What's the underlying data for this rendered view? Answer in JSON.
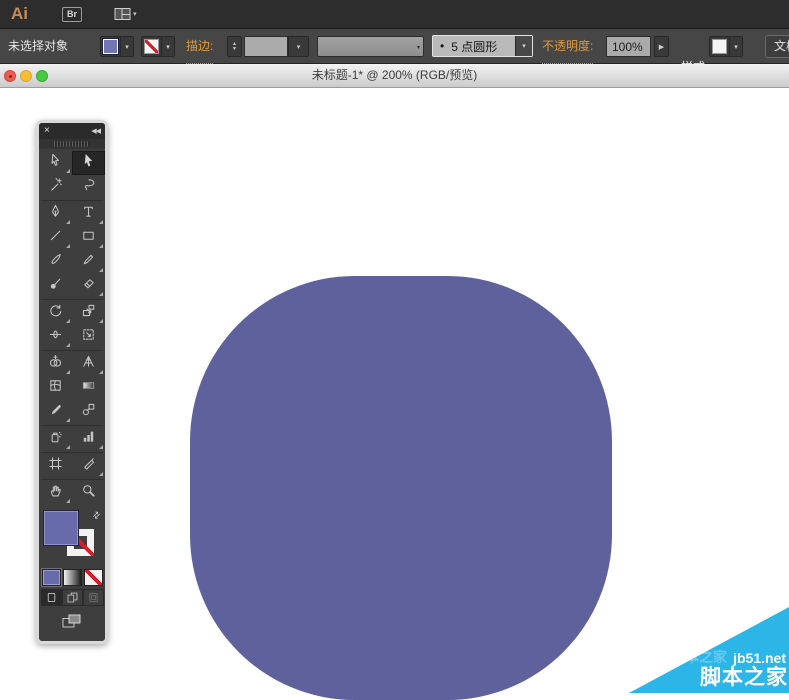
{
  "app_bar": {
    "logo": "Ai",
    "bridge_button": "Br"
  },
  "control_bar": {
    "status_label": "未选择对象",
    "fill_swatch_color": "#7376b4",
    "stroke_swatch": "none",
    "stroke_label": "描边:",
    "stroke_weight_value": "",
    "brush_name": "5 点圆形",
    "opacity_label": "不透明度:",
    "opacity_value": "100%",
    "style_label": "样式:",
    "document_setup_label": "文档设置"
  },
  "window": {
    "title": "未标题-1* @ 200% (RGB/预览)"
  },
  "icons": {
    "chevron-down": "▾",
    "spinner-up": "▲",
    "spinner-down": "▼",
    "expand-right": "▶",
    "bullet": "•",
    "close": "×",
    "collapse": "◀◀",
    "swap": "⇄"
  },
  "tools_panel": {
    "tools": [
      {
        "id": "direct-selection-tool",
        "flyout": true,
        "selected": false
      },
      {
        "id": "selection-tool",
        "flyout": false,
        "selected": true
      },
      {
        "id": "magic-wand-tool",
        "flyout": false,
        "selected": false
      },
      {
        "id": "lasso-tool",
        "flyout": false,
        "selected": false
      },
      {
        "id": "pen-tool",
        "flyout": true,
        "selected": false
      },
      {
        "id": "type-tool",
        "flyout": true,
        "selected": false
      },
      {
        "id": "line-segment-tool",
        "flyout": true,
        "selected": false
      },
      {
        "id": "rectangle-tool",
        "flyout": true,
        "selected": false
      },
      {
        "id": "paintbrush-tool",
        "flyout": false,
        "selected": false
      },
      {
        "id": "pencil-tool",
        "flyout": true,
        "selected": false
      },
      {
        "id": "blob-brush-tool",
        "flyout": false,
        "selected": false
      },
      {
        "id": "eraser-tool",
        "flyout": true,
        "selected": false
      },
      {
        "id": "rotate-tool",
        "flyout": true,
        "selected": false
      },
      {
        "id": "scale-tool",
        "flyout": true,
        "selected": false
      },
      {
        "id": "width-tool",
        "flyout": true,
        "selected": false
      },
      {
        "id": "free-transform-tool",
        "flyout": false,
        "selected": false
      },
      {
        "id": "shape-builder-tool",
        "flyout": true,
        "selected": false
      },
      {
        "id": "perspective-grid-tool",
        "flyout": true,
        "selected": false
      },
      {
        "id": "mesh-tool",
        "flyout": false,
        "selected": false
      },
      {
        "id": "gradient-tool",
        "flyout": false,
        "selected": false
      },
      {
        "id": "eyedropper-tool",
        "flyout": true,
        "selected": false
      },
      {
        "id": "blend-tool",
        "flyout": false,
        "selected": false
      },
      {
        "id": "symbol-sprayer-tool",
        "flyout": true,
        "selected": false
      },
      {
        "id": "column-graph-tool",
        "flyout": true,
        "selected": false
      },
      {
        "id": "artboard-tool",
        "flyout": false,
        "selected": false
      },
      {
        "id": "slice-tool",
        "flyout": true,
        "selected": false
      },
      {
        "id": "hand-tool",
        "flyout": true,
        "selected": false
      },
      {
        "id": "zoom-tool",
        "flyout": false,
        "selected": false
      }
    ],
    "divider_after_rows": [
      2,
      6,
      8,
      11,
      12,
      13
    ],
    "fill_color": "#686ba9",
    "stroke_color": "none"
  },
  "artwork": {
    "shape": "rounded-square",
    "fill": "#5f619c",
    "zoom": "200%"
  },
  "watermark": {
    "site": "jb51.net",
    "name": "脚本之家",
    "color": "#2cb6e8"
  },
  "colors": {
    "app_bar_bg": "#2d2d2d",
    "control_bar_bg": "#464646",
    "panel_bg": "#3e3e3e",
    "accent_orange": "#dd9b40",
    "shape_purple": "#5f619c",
    "watermark_cyan": "#2cb6e8"
  }
}
